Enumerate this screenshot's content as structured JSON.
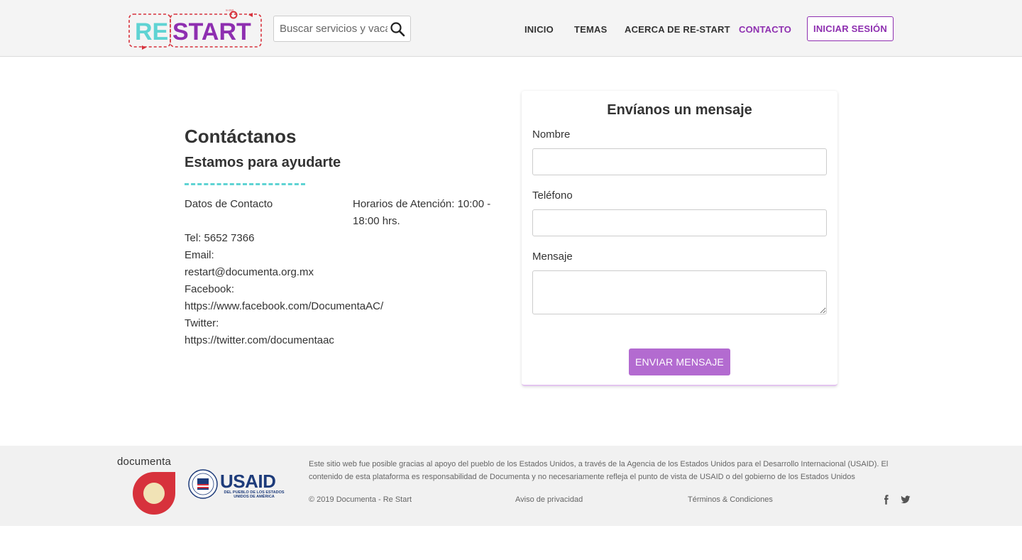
{
  "header": {
    "logo": {
      "text_re": "RE",
      "text_start": "START",
      "tagline": "re-start"
    },
    "search": {
      "placeholder": "Buscar servicios y vacantes"
    },
    "nav": [
      {
        "label": "INICIO"
      },
      {
        "label": "TEMAS"
      },
      {
        "label": "ACERCA DE RE-START"
      },
      {
        "label": "CONTACTO"
      }
    ],
    "login_label": "INICIAR SESIÓN"
  },
  "contact": {
    "title": "Contáctanos",
    "subtitle": "Estamos para ayudarte",
    "data_label": "Datos de Contacto",
    "hours": "Horarios de Atención: 10:00 - 18:00 hrs.",
    "tel": "Tel: 5652 7366",
    "email_label": "Email:",
    "email": "restart@documenta.org.mx",
    "facebook_label": "Facebook:",
    "facebook": "https://www.facebook.com/DocumentaAC/",
    "twitter_label": "Twitter:",
    "twitter": "https://twitter.com/documentaac"
  },
  "form": {
    "title": "Envíanos un mensaje",
    "name_label": "Nombre",
    "name_value": "",
    "phone_label": "Teléfono",
    "phone_value": "",
    "message_label": "Mensaje",
    "message_value": "",
    "submit_label": "ENVIAR MENSAJE"
  },
  "footer": {
    "documenta_word": "documenta",
    "usaid_word": "USAID",
    "usaid_sub": "DEL PUEBLO DE LOS ESTADOS UNIDOS DE AMÉRICA",
    "disclaimer": "Este sitio web fue posible gracias al apoyo del pueblo de los Estados Unidos, a través de la Agencia de los Estados Unidos para el Desarrollo Internacional (USAID). El contenido de esta plataforma es responsabilidad de Documenta y no necesariamente refleja el punto de vista de USAID o del gobierno de los Estados Unidos",
    "copyright": "© 2019 Documenta - Re Start",
    "privacy": "Aviso de privacidad",
    "terms": "Términos & Condiciones",
    "social": [
      {
        "icon": "facebook-icon"
      },
      {
        "icon": "twitter-icon"
      }
    ]
  },
  "colors": {
    "accent": "#8e2fb0",
    "button": "#b36bd0",
    "teal": "#5fd3d3",
    "logo_red": "#d7323c",
    "usaid_blue": "#1d3b7a"
  }
}
